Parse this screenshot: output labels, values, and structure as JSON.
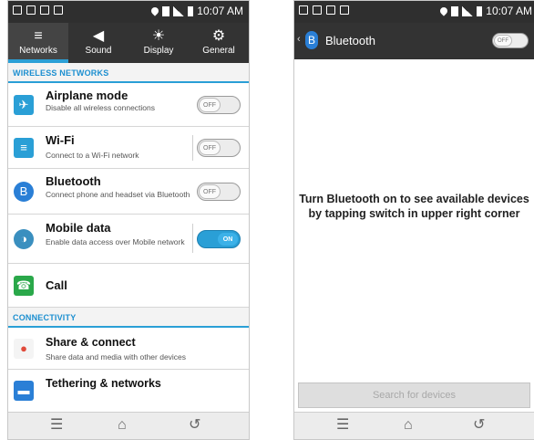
{
  "status": {
    "time": "10:07 AM",
    "time_short": "10:07 AM"
  },
  "tabs": [
    {
      "label": "Networks",
      "icon": "wifi-icon",
      "glyph": "≡"
    },
    {
      "label": "Sound",
      "icon": "speaker-icon",
      "glyph": "◀"
    },
    {
      "label": "Display",
      "icon": "brightness-icon",
      "glyph": "☀"
    },
    {
      "label": "General",
      "icon": "gear-icon",
      "glyph": "⚙"
    }
  ],
  "sections": {
    "wireless": "WIRELESS NETWORKS",
    "connectivity": "CONNECTIVITY"
  },
  "settings": [
    {
      "title": "Airplane mode",
      "subtitle": "Disable all wireless connections",
      "toggle": "OFF",
      "on": false,
      "color": "#2a9fd6",
      "icon": "airplane-icon",
      "glyph": "✈"
    },
    {
      "title": "Wi-Fi",
      "subtitle": "Connect to a Wi-Fi network",
      "toggle": "OFF",
      "on": false,
      "color": "#2a9fd6",
      "icon": "wifi-icon",
      "glyph": "≡"
    },
    {
      "title": "Bluetooth",
      "subtitle": "Connect phone and headset via Bluetooth",
      "toggle": "OFF",
      "on": false,
      "color": "#2a7fd6",
      "icon": "bluetooth-icon",
      "glyph": "B"
    },
    {
      "title": "Mobile data",
      "subtitle": "Enable data access over Mobile network",
      "toggle": "ON",
      "on": true,
      "color": "#3a8fbf",
      "icon": "mobile-data-icon",
      "glyph": "◑"
    },
    {
      "title": "Call",
      "subtitle": "",
      "color": "#2aa84a",
      "icon": "phone-icon",
      "glyph": "☎"
    }
  ],
  "connectivity": [
    {
      "title": "Share & connect",
      "subtitle": "Share data and media with other devices",
      "color": "#e04a3a",
      "icon": "share-icon",
      "glyph": "●"
    },
    {
      "title": "Tethering & networks",
      "subtitle": "",
      "color": "#2a7fd6",
      "icon": "tethering-icon",
      "glyph": "▬"
    }
  ],
  "bluetooth": {
    "title": "Bluetooth",
    "toggle": "OFF",
    "message": "Turn Bluetooth on to see available devices by tapping switch in upper right corner",
    "search_button": "Search for devices"
  },
  "colors": {
    "accent": "#2a9fd6",
    "bar": "#333333"
  }
}
